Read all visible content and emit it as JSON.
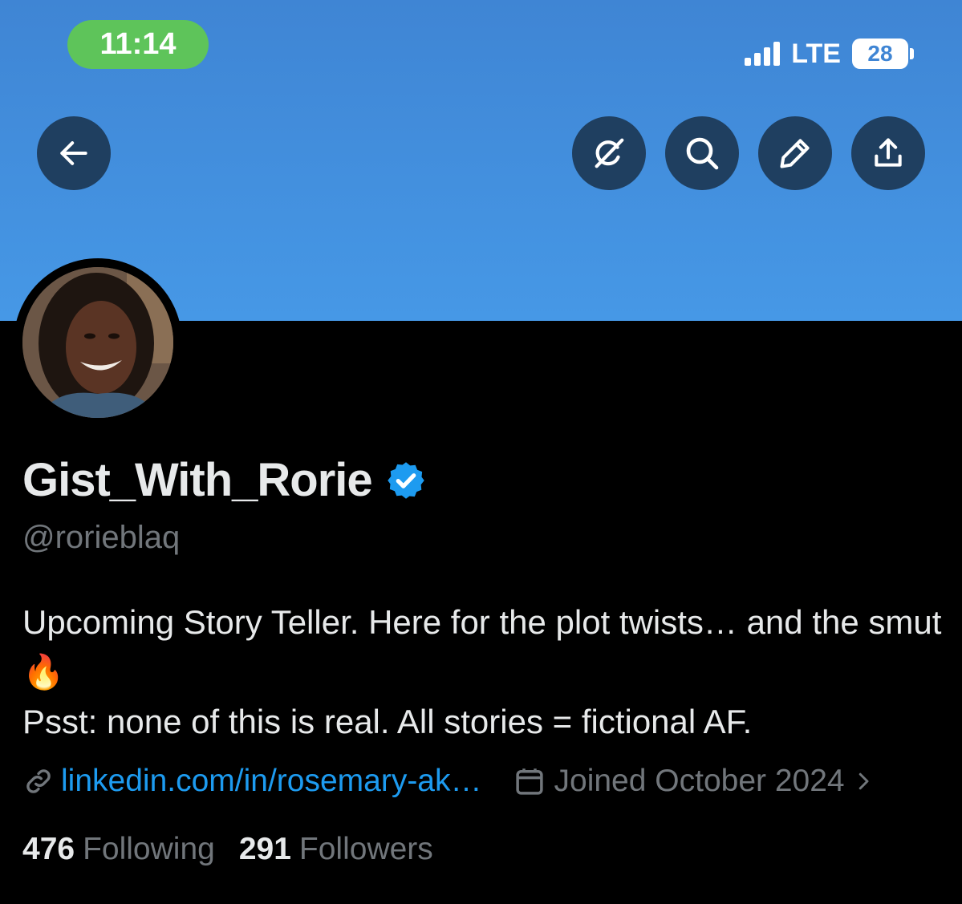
{
  "status_bar": {
    "time": "11:14",
    "network": "LTE",
    "battery": "28"
  },
  "toolbar": {
    "back_icon": "arrow-left-icon",
    "grok_icon": "grok-icon",
    "search_icon": "search-icon",
    "edit_icon": "pencil-icon",
    "share_icon": "share-icon"
  },
  "colors": {
    "banner": "#4698e6",
    "verified": "#1d9bf0",
    "link": "#1d9bf0",
    "muted": "#71767b"
  },
  "profile": {
    "display_name": "Gist_With_Rorie",
    "handle": "@rorieblaq",
    "bio_line1": "Upcoming Story Teller. Here for the plot twists… and the smut 🔥",
    "bio_line2": "Psst: none of this is real. All stories = fictional AF.",
    "link": "linkedin.com/in/rosemary-ak…",
    "joined": "Joined October 2024",
    "following_count": "476",
    "following_label": "Following",
    "followers_count": "291",
    "followers_label": "Followers"
  }
}
